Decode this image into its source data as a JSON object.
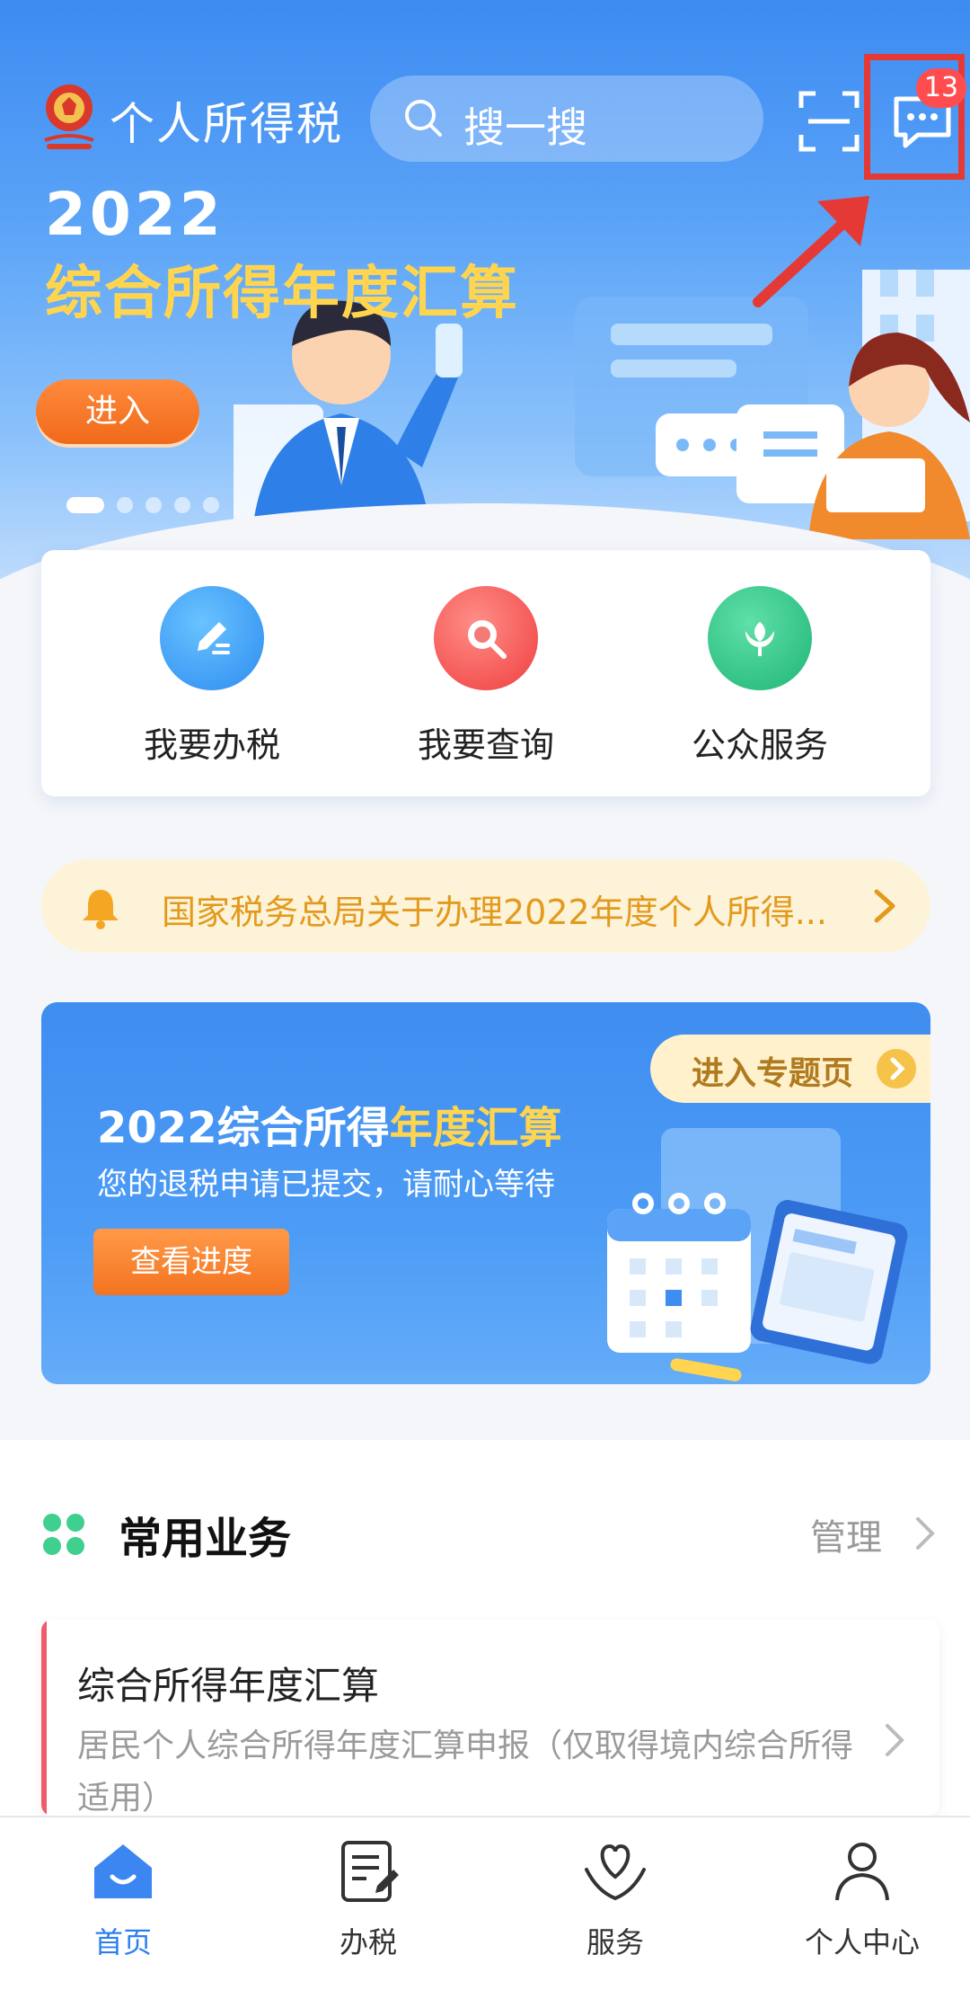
{
  "header": {
    "app_title": "个人所得税",
    "search_placeholder": "搜一搜",
    "message_badge": "13"
  },
  "banner": {
    "year": "2022",
    "title": "综合所得年度汇算",
    "enter_label": "进入",
    "page_count": 5,
    "active_page": 1
  },
  "quick_actions": [
    {
      "label": "我要办税",
      "icon": "pencil-icon"
    },
    {
      "label": "我要查询",
      "icon": "magnifier-icon"
    },
    {
      "label": "公众服务",
      "icon": "flower-icon"
    }
  ],
  "notice": {
    "text": "国家税务总局关于办理2022年度个人所得..."
  },
  "promo": {
    "tag": "进入专题页",
    "title_part1": "2022综合所得",
    "title_part2": "年度汇算",
    "subtitle": "您的退税申请已提交，请耐心等待",
    "button": "查看进度"
  },
  "common": {
    "title": "常用业务",
    "manage": "管理",
    "card_title": "综合所得年度汇算",
    "card_desc": "居民个人综合所得年度汇算申报（仅取得境内综合所得适用）"
  },
  "tabs": [
    {
      "label": "首页",
      "icon": "home-icon",
      "active": true
    },
    {
      "label": "办税",
      "icon": "document-edit-icon",
      "active": false
    },
    {
      "label": "服务",
      "icon": "heart-hands-icon",
      "active": false
    },
    {
      "label": "个人中心",
      "icon": "person-icon",
      "active": false
    }
  ],
  "colors": {
    "primary": "#2d7ff0",
    "accent_orange": "#f47320",
    "highlight_yellow": "#ffd54f",
    "notice_text": "#e39a1c",
    "badge_red": "#ff4d4f"
  }
}
